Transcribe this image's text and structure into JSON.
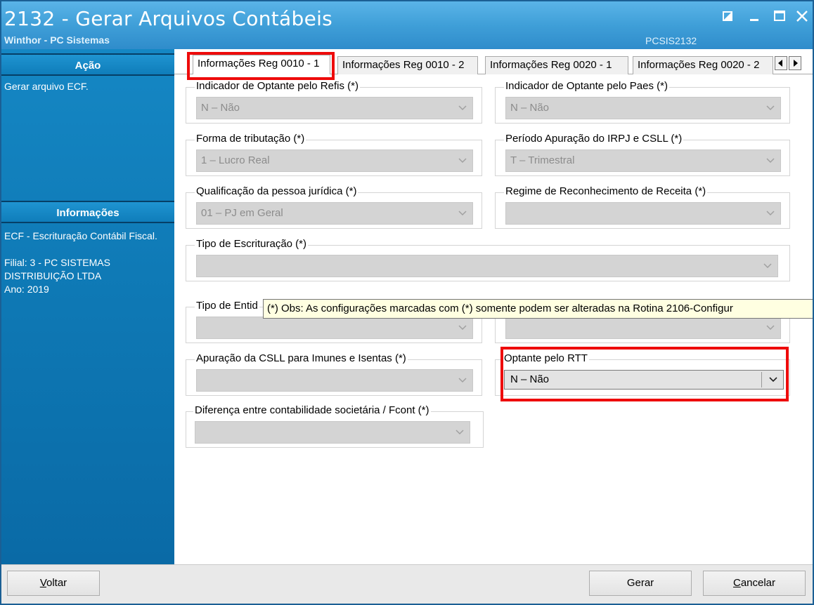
{
  "window": {
    "title": "2132 - Gerar Arquivos Contábeis",
    "subtitle": "Winthor - PC Sistemas",
    "routine_code": "PCSIS2132"
  },
  "sidebar": {
    "acao_heading": "Ação",
    "acao_text": "Gerar arquivo ECF.",
    "info_heading": "Informações",
    "info_text": "ECF - Escrituração Contábil Fiscal.\n\nFilial: 3 - PC SISTEMAS DISTRIBUIÇÃO LTDA\nAno: 2019"
  },
  "tabs": [
    {
      "label": "Informações Reg 0010 - 1",
      "active": true
    },
    {
      "label": "Informações Reg 0010 - 2",
      "active": false
    },
    {
      "label": "Informações Reg 0020 - 1",
      "active": false
    },
    {
      "label": "Informações Reg 0020 - 2",
      "active": false
    }
  ],
  "fields": {
    "refis": {
      "label": "Indicador de Optante pelo Refis (*)",
      "value": "N – Não"
    },
    "paes": {
      "label": "Indicador de Optante pelo Paes (*)",
      "value": "N – Não"
    },
    "tributacao": {
      "label": "Forma de tributação (*)",
      "value": "1 – Lucro Real"
    },
    "periodo": {
      "label": "Período Apuração do IRPJ e CSLL (*)",
      "value": "T – Trimestral"
    },
    "qualificacao": {
      "label": "Qualificação da pessoa jurídica (*)",
      "value": "01 – PJ em Geral"
    },
    "regime": {
      "label": "Regime de Reconhecimento de Receita (*)",
      "value": ""
    },
    "escrituracao": {
      "label": "Tipo de Escrituração (*)",
      "value": ""
    },
    "entidade": {
      "label": "Tipo de Entid",
      "value": ""
    },
    "entidade_right": {
      "value": ""
    },
    "csll": {
      "label": "Apuração da CSLL para Imunes e Isentas (*)",
      "value": ""
    },
    "rtt": {
      "label": "Optante pelo RTT",
      "value": "N – Não"
    },
    "fcont": {
      "label": "Diferença entre contabilidade societária / Fcont (*)",
      "value": ""
    }
  },
  "tooltip": {
    "text": "(*) Obs: As configurações marcadas com (*) somente podem ser alteradas na Rotina 2106-Configur"
  },
  "buttons": {
    "voltar": {
      "mnemonic": "V",
      "rest": "oltar"
    },
    "gerar": "Gerar",
    "cancelar": {
      "mnemonic": "C",
      "rest": "ancelar"
    }
  },
  "colors": {
    "titlebar": "#3f9fd8",
    "sidebar": "#0e78b4",
    "highlight": "#ee0b0b",
    "tooltip_bg": "#ffffe1"
  }
}
